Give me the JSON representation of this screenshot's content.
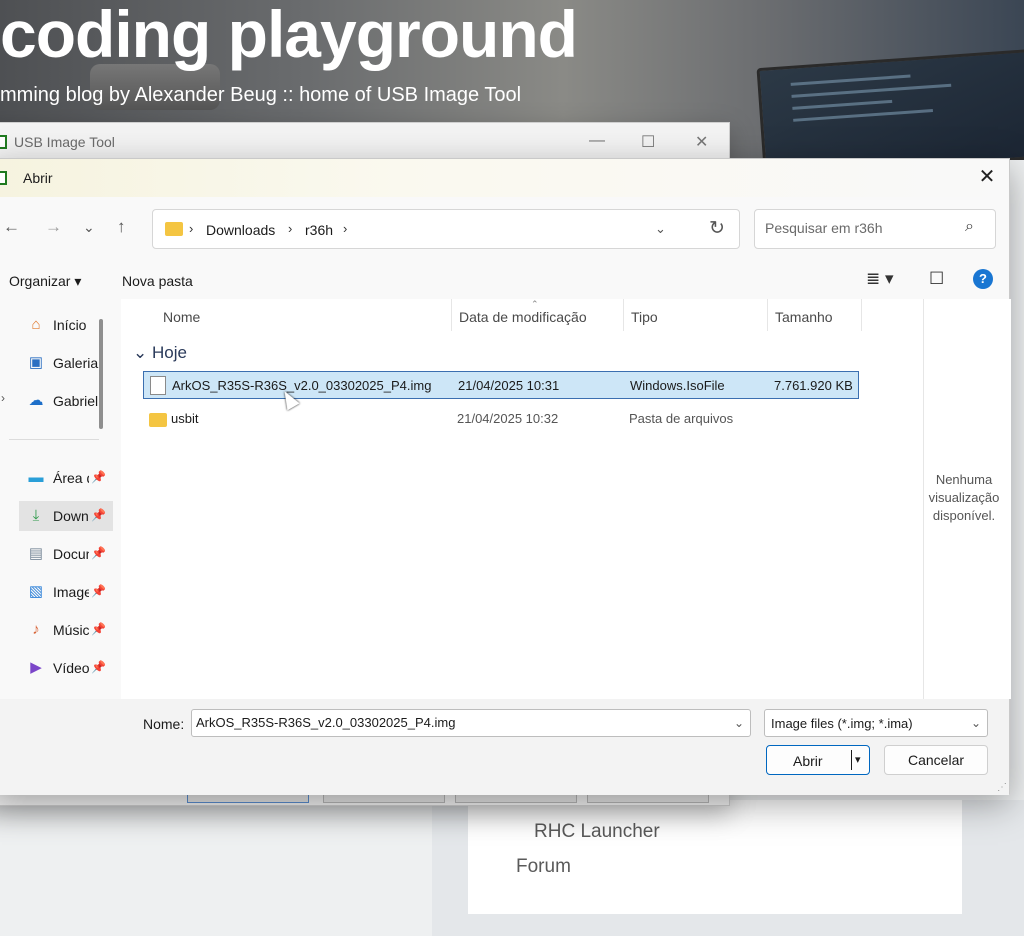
{
  "site": {
    "title": "coding playground",
    "tagline": "mming blog by Alexander Beug :: home of USB Image Tool",
    "sidebar_links": [
      "RHC Launcher",
      "Forum"
    ]
  },
  "usb_window": {
    "title": "USB Image Tool",
    "controls": {
      "minimize": "—",
      "maximize": "☐",
      "close": "✕"
    }
  },
  "dialog": {
    "title": "Abrir",
    "close": "✕",
    "nav": {
      "back": "←",
      "forward": "→",
      "recent": "⌄",
      "up": "↑"
    },
    "address": {
      "crumbs": [
        "Downloads",
        "r36h"
      ],
      "separator": "›",
      "dropdown": "⌄",
      "refresh": "↻"
    },
    "search": {
      "placeholder": "Pesquisar em r36h",
      "icon": "⌕"
    },
    "commands": {
      "organize": "Organizar ▾",
      "new_folder": "Nova pasta",
      "view": "≣ ▾",
      "preview_pane": "☐",
      "help": "?"
    },
    "nav_pane": {
      "items": [
        {
          "label": "Início",
          "icon": "home-icon",
          "glyph": "⌂",
          "color": "#e07a2f"
        },
        {
          "label": "Galeria",
          "icon": "gallery-icon",
          "glyph": "▣",
          "color": "#2b6fc2"
        },
        {
          "label": "Gabriel - Pessoal",
          "icon": "onedrive-icon",
          "glyph": "☁",
          "color": "#1d6fc9"
        },
        {
          "label": "Área de Trabalho",
          "icon": "desktop-icon",
          "glyph": "▬",
          "color": "#2a9fd8"
        },
        {
          "label": "Downloads",
          "icon": "download-icon",
          "glyph": "⤓",
          "color": "#2e9a4a"
        },
        {
          "label": "Documentos",
          "icon": "documents-icon",
          "glyph": "▤",
          "color": "#7a8a9a"
        },
        {
          "label": "Imagens",
          "icon": "pictures-icon",
          "glyph": "▧",
          "color": "#2b7fd8"
        },
        {
          "label": "Músicas",
          "icon": "music-icon",
          "glyph": "♪",
          "color": "#d8663a"
        },
        {
          "label": "Vídeos",
          "icon": "videos-icon",
          "glyph": "▶",
          "color": "#7b46c9"
        }
      ],
      "expand": "›",
      "pin": "📌"
    },
    "columns": [
      "Nome",
      "Data de modificação",
      "Tipo",
      "Tamanho"
    ],
    "group": "Hoje",
    "group_toggle": "⌄",
    "files": [
      {
        "name": "ArkOS_R35S-R36S_v2.0_03302025_P4.img",
        "date": "21/04/2025 10:31",
        "type": "Windows.IsoFile",
        "size": "7.761.920 KB",
        "kind": "file",
        "selected": true
      },
      {
        "name": "usbit",
        "date": "21/04/2025 10:32",
        "type": "Pasta de arquivos",
        "size": "",
        "kind": "folder",
        "selected": false
      }
    ],
    "preview_text": "Nenhuma visualização disponível.",
    "footer": {
      "filename_label": "Nome:",
      "filename_value": "ArkOS_R35S-R36S_v2.0_03302025_P4.img",
      "filter_value": "Image files (*.img; *.ima)",
      "open_label": "Abrir",
      "cancel_label": "Cancelar",
      "dropdown": "⌄",
      "split_arrow": "▾"
    }
  }
}
